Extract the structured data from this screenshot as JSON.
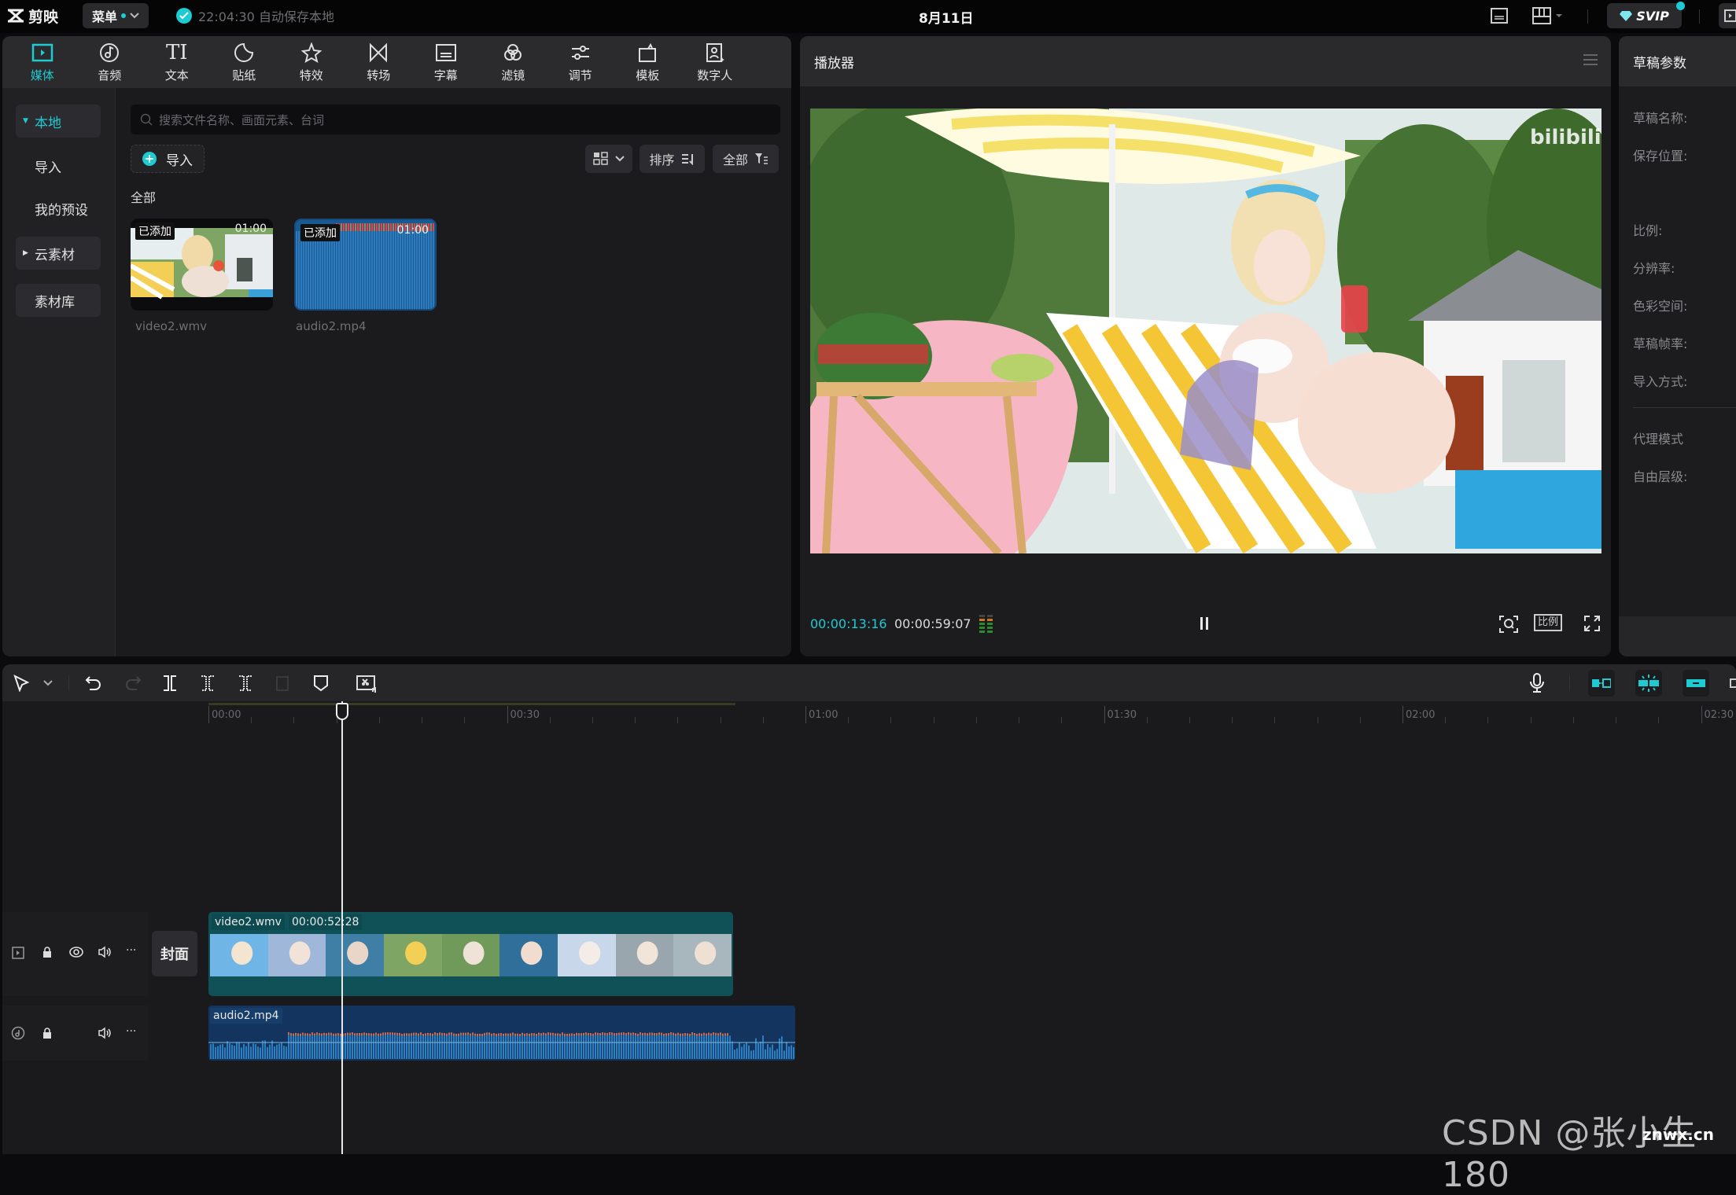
{
  "app": {
    "name": "剪映",
    "menu_label": "菜单",
    "autosave_text": "22:04:30 自动保存本地",
    "date": "8月11日",
    "svip_label": "SVIP"
  },
  "toolbar_tabs": [
    {
      "label": "媒体",
      "icon": "media-icon",
      "active": true
    },
    {
      "label": "音频",
      "icon": "audio-icon"
    },
    {
      "label": "文本",
      "icon": "text-icon"
    },
    {
      "label": "贴纸",
      "icon": "sticker-icon"
    },
    {
      "label": "特效",
      "icon": "effects-icon"
    },
    {
      "label": "转场",
      "icon": "transition-icon"
    },
    {
      "label": "字幕",
      "icon": "subtitle-icon"
    },
    {
      "label": "滤镜",
      "icon": "filter-icon"
    },
    {
      "label": "调节",
      "icon": "adjust-icon"
    },
    {
      "label": "模板",
      "icon": "template-icon"
    },
    {
      "label": "数字人",
      "icon": "digital-human-icon"
    }
  ],
  "media_nav": {
    "local": "本地",
    "import": "导入",
    "my_presets": "我的预设",
    "cloud": "云素材",
    "library": "素材库"
  },
  "media": {
    "search_placeholder": "搜索文件名称、画面元素、台词",
    "import_label": "导入",
    "sort_label": "排序",
    "filter_label": "全部",
    "section_label": "全部",
    "items": [
      {
        "name": "video2.wmv",
        "badge": "已添加",
        "duration": "01:00",
        "type": "video"
      },
      {
        "name": "audio2.mp4",
        "badge": "已添加",
        "duration": "01:00",
        "type": "audio"
      }
    ]
  },
  "player": {
    "title": "播放器",
    "current_time": "00:00:13:16",
    "total_time": "00:00:59:07",
    "ratio_label": "比例",
    "watermark": "bilibili"
  },
  "draft_params": {
    "title": "草稿参数",
    "fields": [
      "草稿名称:",
      "保存位置:",
      "比例:",
      "分辨率:",
      "色彩空间:",
      "草稿帧率:",
      "导入方式:"
    ],
    "proxy_mode": "代理模式",
    "free_layer": "自由层级:"
  },
  "timeline": {
    "ruler_labels": [
      "00:00",
      "00:30",
      "01:00",
      "01:30",
      "02:00",
      "02:30"
    ],
    "cover_label": "封面",
    "video_clip": {
      "name": "video2.wmv",
      "duration": "00:00:52:28"
    },
    "audio_clip": {
      "name": "audio2.mp4"
    },
    "playhead_time": "00:00:13:16"
  },
  "watermark": {
    "csdn": "CSDN @张小生180",
    "site": "znwx.cn"
  },
  "colors": {
    "accent": "#1ecbd2",
    "video_clip": "#0f5157",
    "audio_clip": "#13345e"
  }
}
